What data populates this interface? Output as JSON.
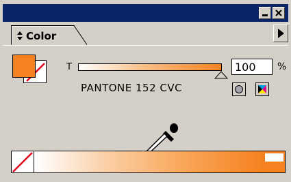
{
  "panel": {
    "tab_label": "Color"
  },
  "tint": {
    "letter": "T",
    "value": "100",
    "unit": "%",
    "level": 1.0
  },
  "swatch": {
    "name": "PANTONE 152 CVC"
  },
  "colors": {
    "fill": "#f58220",
    "stroke": "#ffffff",
    "titlebar": "#0a246a",
    "panel_bg": "#d4d0c8"
  },
  "icons": {
    "minimize": "minimize-icon",
    "close": "close-icon",
    "menu": "menu-arrow-icon",
    "tab_arrows": "updown-arrows-icon",
    "spot": "spot-color-icon",
    "cmyk": "cmyk-icon",
    "eyedropper": "eyedropper-icon",
    "none": "none-swatch-icon"
  }
}
